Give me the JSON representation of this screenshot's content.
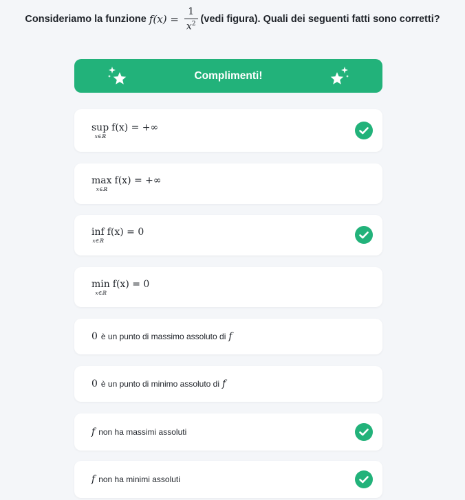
{
  "question": {
    "prefix": "Consideriamo la funzione",
    "func": "f(x) =",
    "frac_num": "1",
    "frac_den_base": "x",
    "frac_den_exp": "2",
    "suffix": "(vedi figura). Quali dei seguenti fatti sono corretti?"
  },
  "banner": {
    "label": "Complimenti!",
    "color": "#22b27a",
    "icon": "sparkle-stars-icon"
  },
  "options": [
    {
      "op": "sup",
      "sub": "x∈ℝ",
      "expr": "f(x) = +∞",
      "correct": true
    },
    {
      "op": "max",
      "sub": "x∈ℝ",
      "expr": "f(x) = +∞",
      "correct": false
    },
    {
      "op": "inf",
      "sub": "x∈ℝ",
      "expr": "f(x) = 0",
      "correct": true
    },
    {
      "op": "min",
      "sub": "x∈ℝ",
      "expr": "f(x) = 0",
      "correct": false
    },
    {
      "lead": "0",
      "text": "è un punto di massimo assoluto di",
      "tail": "f",
      "correct": false
    },
    {
      "lead": "0",
      "text": "è un punto di minimo assoluto di",
      "tail": "f",
      "correct": false
    },
    {
      "lead": "f",
      "text": "non ha massimi assoluti",
      "tail": "",
      "correct": true
    },
    {
      "lead": "f",
      "text": "non ha minimi assoluti",
      "tail": "",
      "correct": true
    }
  ],
  "colors": {
    "check": "#22b27a",
    "background": "#f4f6f9"
  }
}
